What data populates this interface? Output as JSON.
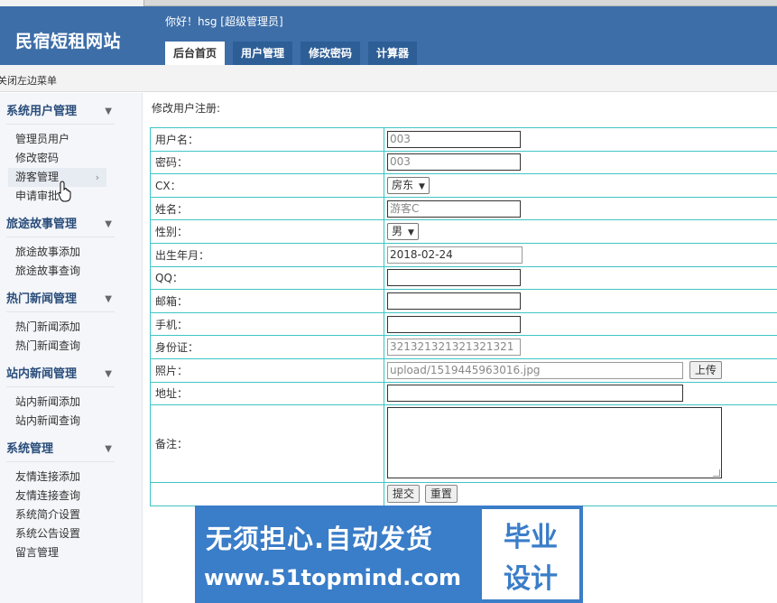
{
  "header": {
    "logo": "民宿短租网站",
    "greeting": "你好！hsg [超级管理员]",
    "nav": [
      {
        "label": "后台首页",
        "active": true
      },
      {
        "label": "用户管理",
        "active": false
      },
      {
        "label": "修改密码",
        "active": false
      },
      {
        "label": "计算器",
        "active": false
      }
    ]
  },
  "subbar": {
    "toggle_label": "关闭左边菜单"
  },
  "sidebar": {
    "groups": [
      {
        "title": "系统用户管理",
        "items": [
          "管理员用户",
          "修改密码",
          "游客管理",
          "申请审批"
        ]
      },
      {
        "title": "旅途故事管理",
        "items": [
          "旅途故事添加",
          "旅途故事查询"
        ]
      },
      {
        "title": "热门新闻管理",
        "items": [
          "热门新闻添加",
          "热门新闻查询"
        ]
      },
      {
        "title": "站内新闻管理",
        "items": [
          "站内新闻添加",
          "站内新闻查询"
        ]
      },
      {
        "title": "系统管理",
        "items": [
          "友情连接添加",
          "友情连接查询",
          "系统简介设置",
          "系统公告设置",
          "留言管理"
        ]
      }
    ]
  },
  "main": {
    "title": "修改用户注册:",
    "fields": {
      "username": {
        "label": "用户名：",
        "value": "003"
      },
      "password": {
        "label": "密码：",
        "value": "003"
      },
      "cx": {
        "label": "CX：",
        "value": "房东"
      },
      "name": {
        "label": "姓名：",
        "value": "游客C"
      },
      "gender": {
        "label": "性别：",
        "value": "男"
      },
      "birth": {
        "label": "出生年月：",
        "value": "2018-02-24"
      },
      "qq": {
        "label": "QQ：",
        "value": ""
      },
      "email": {
        "label": "邮箱：",
        "value": ""
      },
      "phone": {
        "label": "手机：",
        "value": ""
      },
      "idcard": {
        "label": "身份证：",
        "value": "321321321321321321"
      },
      "photo": {
        "label": "照片：",
        "value": "upload/1519445963016.jpg",
        "upload_label": "上传"
      },
      "address": {
        "label": "地址：",
        "value": ""
      },
      "remark": {
        "label": "备注：",
        "value": ""
      }
    },
    "submit_label": "提交",
    "reset_label": "重置"
  },
  "watermark": {
    "line1": "无须担心.自动发货",
    "line2": "www.51topmind.com",
    "badge_top": "毕业",
    "badge_bottom": "设计"
  },
  "colors": {
    "header_bg": "#3d6ea8",
    "table_border": "#40c4c4",
    "watermark_bg": "#3a7dc8"
  }
}
